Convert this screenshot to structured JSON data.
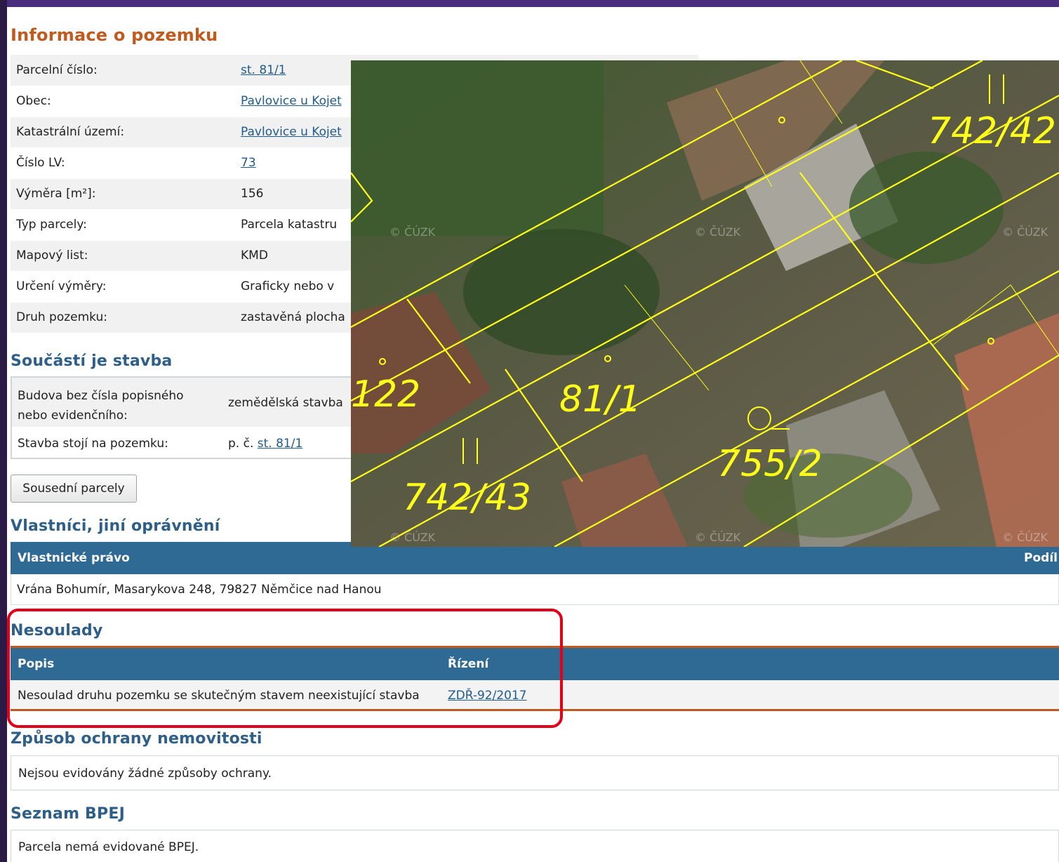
{
  "title": "Informace o pozemku",
  "info_rows": [
    {
      "label": "Parcelní číslo:",
      "value": "st. 81/1",
      "link": true
    },
    {
      "label": "Obec:",
      "value": "Pavlovice u Kojet",
      "link": true
    },
    {
      "label": "Katastrální území:",
      "value": "Pavlovice u Kojet",
      "link": true
    },
    {
      "label": "Číslo LV:",
      "value": "73",
      "link": true
    },
    {
      "label": "Výměra [m²]:",
      "value": "156",
      "link": false
    },
    {
      "label": "Typ parcely:",
      "value": "Parcela katastru",
      "link": false
    },
    {
      "label": "Mapový list:",
      "value": "KMD",
      "link": false
    },
    {
      "label": "Určení výměry:",
      "value": "Graficky nebo v",
      "link": false
    },
    {
      "label": "Druh pozemku:",
      "value": "zastavěná plocha",
      "link": false
    }
  ],
  "stavba": {
    "heading": "Součástí je stavba",
    "row1_label_line1": "Budova bez čísla popisného",
    "row1_label_line2": "nebo evidenčního:",
    "row1_value": "zemědělská stavba",
    "row2_label": "Stavba stojí na pozemku:",
    "row2_prefix": "p. č.",
    "row2_link": "st. 81/1"
  },
  "neighbors_button": "Sousední parcely",
  "owners": {
    "heading": "Vlastníci, jiní oprávnění",
    "col_right": "Vlastnické právo",
    "col_share": "Podíl",
    "row": "Vrána Bohumír, Masarykova 248, 79827 Němčice nad Hanou"
  },
  "nesoulady": {
    "heading": "Nesoulady",
    "col_popis": "Popis",
    "col_rizeni": "Řízení",
    "row_popis": "Nesoulad druhu pozemku se skutečným stavem neexistující stavba",
    "row_rizeni": "ZDŘ-92/2017"
  },
  "ochrana": {
    "heading": "Způsob ochrany nemovitosti",
    "text": "Nejsou evidovány žádné způsoby ochrany."
  },
  "bpej": {
    "heading": "Seznam BPEJ",
    "text": "Parcela nemá evidované BPEJ."
  },
  "map": {
    "labels": [
      "742/42",
      "122",
      "81/1",
      "755/2",
      "742/43"
    ],
    "watermark": "© ČÚZK",
    "line_color": "#ffff1a"
  }
}
